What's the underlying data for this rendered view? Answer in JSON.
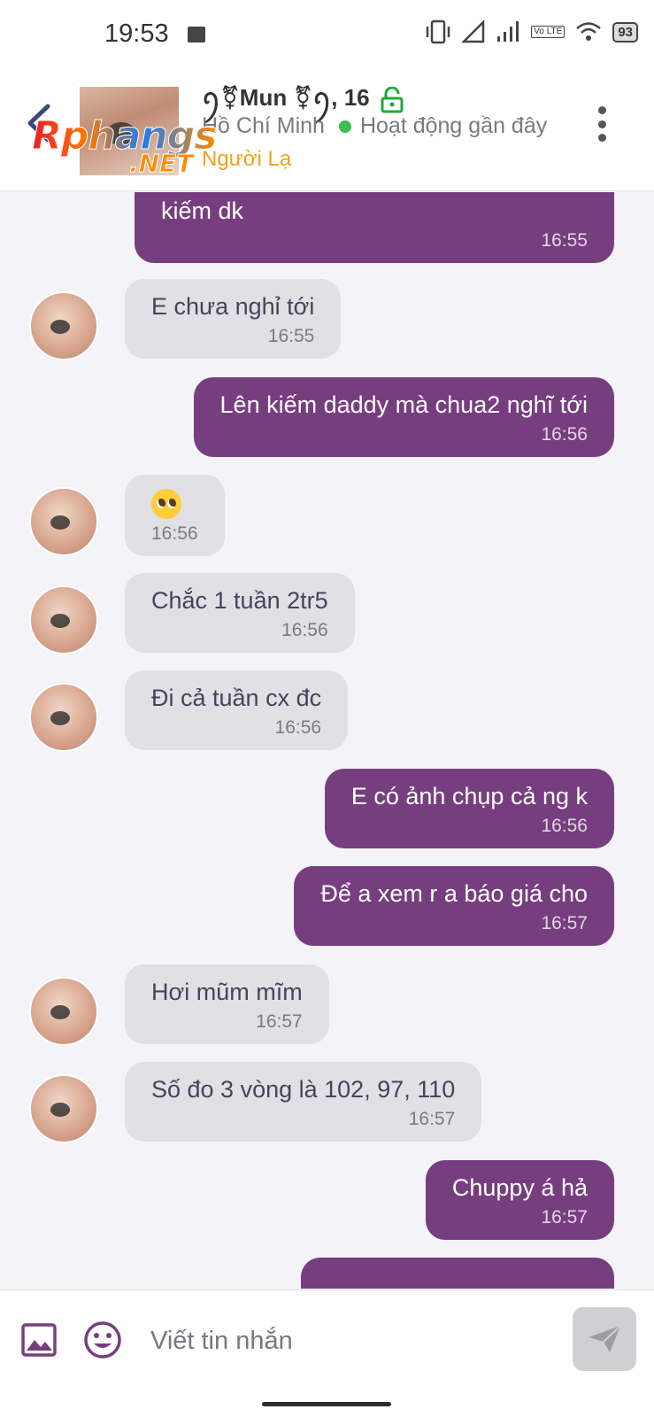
{
  "status_bar": {
    "time": "19:53",
    "battery": "93",
    "volte": "Vo LTE"
  },
  "header": {
    "logo_main": "Rphangs",
    "logo_sub": ".NET",
    "contact_name": "ꪆ⚧Mun ⚧ꪆ, 16",
    "location": "Hồ Chí Minh",
    "activity_status": "Hoạt động gần đây",
    "relationship_tag": "Người Lạ",
    "colors": {
      "online": "#3dbd4f",
      "tag": "#f2a11c",
      "lock": "#1faa3a"
    }
  },
  "messages": [
    {
      "dir": "out",
      "text": "kiếm dk",
      "time": "16:55"
    },
    {
      "dir": "in",
      "text": "E chưa nghỉ tới",
      "time": "16:55"
    },
    {
      "dir": "out",
      "text": "Lên kiếm daddy mà chua2 nghĩ tới",
      "time": "16:56"
    },
    {
      "dir": "in",
      "text": "🥺",
      "time": "16:56",
      "emoji": "pleading-face-icon"
    },
    {
      "dir": "in",
      "text": "Chắc 1 tuần 2tr5",
      "time": "16:56"
    },
    {
      "dir": "in",
      "text": "Đi cả tuần cx đc",
      "time": "16:56"
    },
    {
      "dir": "out",
      "text": "E có ảnh chụp cả ng k",
      "time": "16:56"
    },
    {
      "dir": "out",
      "text": "Để a xem r a báo giá cho",
      "time": "16:57"
    },
    {
      "dir": "in",
      "text": "Hơi mũm mĩm",
      "time": "16:57"
    },
    {
      "dir": "in",
      "text": "Số đo 3 vòng là 102, 97, 110",
      "time": "16:57"
    },
    {
      "dir": "out",
      "text": "Chuppy á hả",
      "time": "16:57"
    }
  ],
  "composer": {
    "placeholder": "Viết tin nhắn"
  },
  "colors": {
    "outgoing_bubble": "#773e7f",
    "incoming_bubble": "#e1e0e4",
    "background": "#f4f3f8"
  }
}
